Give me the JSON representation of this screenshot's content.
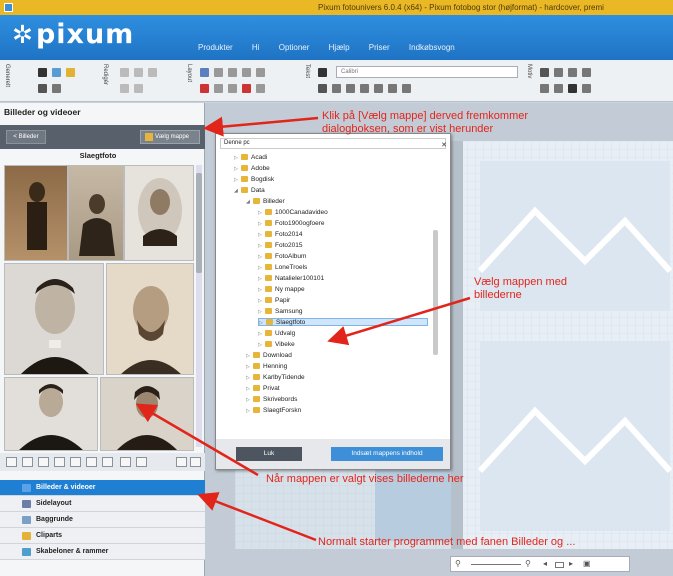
{
  "window": {
    "title": "Pixum fotounivers 6.0.4 (x64) - Pixum fotobog stor (højformat) - hardcover, premi"
  },
  "header": {
    "logo": "pixum",
    "menu": [
      "Produkter",
      "Hi",
      "Optioner",
      "Hjælp",
      "Priser",
      "Indkøbsvogn"
    ]
  },
  "toolbar": {
    "groups": [
      "Generelt",
      "Redigér",
      "Layout",
      "Tekst",
      "Motiv"
    ],
    "font_name": "Calibri"
  },
  "left_panel": {
    "title": "Billeder og videoer",
    "back_button": "< Billeder",
    "choose_folder_button": "Vælg mappe",
    "folder_heading": "Slaegtfoto"
  },
  "dialog": {
    "location": "Denne pc",
    "tree": [
      {
        "label": "Acadi",
        "level": 1,
        "expanded": false
      },
      {
        "label": "Adobe",
        "level": 1,
        "expanded": false
      },
      {
        "label": "Bogdisk",
        "level": 1,
        "expanded": false
      },
      {
        "label": "Data",
        "level": 1,
        "expanded": true
      },
      {
        "label": "Billeder",
        "level": 2,
        "expanded": true
      },
      {
        "label": "1000Canadavideo",
        "level": 3,
        "expanded": false
      },
      {
        "label": "Foto1900ogfoere",
        "level": 3,
        "expanded": false
      },
      {
        "label": "Foto2014",
        "level": 3,
        "expanded": false
      },
      {
        "label": "Foto2015",
        "level": 3,
        "expanded": false
      },
      {
        "label": "FotoAlbum",
        "level": 3,
        "expanded": false
      },
      {
        "label": "LoneTroels",
        "level": 3,
        "expanded": false
      },
      {
        "label": "Natalieler100101",
        "level": 3,
        "expanded": false
      },
      {
        "label": "Ny mappe",
        "level": 3,
        "expanded": false
      },
      {
        "label": "Papir",
        "level": 3,
        "expanded": false
      },
      {
        "label": "Samsung",
        "level": 3,
        "expanded": false
      },
      {
        "label": "Slaegtfoto",
        "level": 3,
        "expanded": false,
        "selected": true
      },
      {
        "label": "Udvalg",
        "level": 3,
        "expanded": false
      },
      {
        "label": "Vibeke",
        "level": 3,
        "expanded": false
      },
      {
        "label": "Download",
        "level": 2,
        "expanded": false
      },
      {
        "label": "Henning",
        "level": 2,
        "expanded": false
      },
      {
        "label": "KarlbyTidende",
        "level": 2,
        "expanded": false
      },
      {
        "label": "Privat",
        "level": 2,
        "expanded": false
      },
      {
        "label": "Skrivebords",
        "level": 2,
        "expanded": false
      },
      {
        "label": "SlaegtForskn",
        "level": 2,
        "expanded": false
      }
    ],
    "ok_button": "Luk",
    "add_all_button": "Indsæt mappens indhold"
  },
  "tabs": [
    {
      "label": "Billeder & videoer",
      "active": true,
      "color": "#5aa3e8"
    },
    {
      "label": "Sidelayout",
      "active": false,
      "color": "#6b7fa6"
    },
    {
      "label": "Baggrunde",
      "active": false,
      "color": "#7aa0c8"
    },
    {
      "label": "Cliparts",
      "active": false,
      "color": "#e3b23a"
    },
    {
      "label": "Skabeloner & rammer",
      "active": false,
      "color": "#4e9fd0"
    }
  ],
  "annotations": {
    "a1_line1": "Klik på [Vælg mappe] derved fremkommer",
    "a1_line2": "dialogboksen, som er vist herunder",
    "a2_line1": "Vælg mappen med",
    "a2_line2": "billederne",
    "a3": "Når mappen er valgt vises billederne her",
    "a4": "Normalt starter programmet med fanen Billeder og ..."
  },
  "colors": {
    "titlebar": "#e9b824",
    "header": "#1f73c4",
    "accent": "#3d8fd8",
    "annotation": "#e2251b"
  }
}
